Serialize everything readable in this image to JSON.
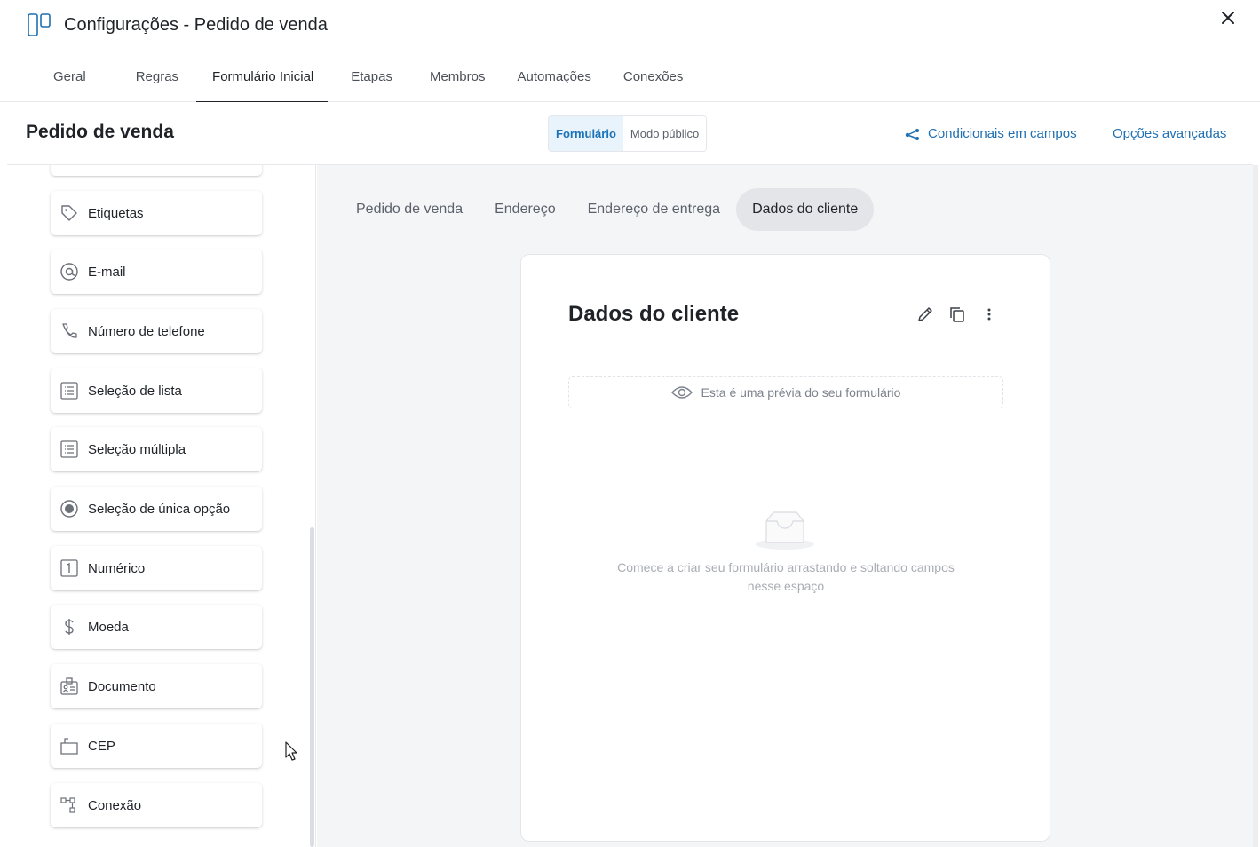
{
  "window": {
    "title": "Configurações - Pedido de venda",
    "app_icon": "board-columns-icon",
    "close_icon": "close-icon"
  },
  "tabs": [
    {
      "label": "Geral",
      "active": false
    },
    {
      "label": "Regras",
      "active": false
    },
    {
      "label": "Formulário Inicial",
      "active": true
    },
    {
      "label": "Etapas",
      "active": false
    },
    {
      "label": "Membros",
      "active": false
    },
    {
      "label": "Automações",
      "active": false
    },
    {
      "label": "Conexões",
      "active": false
    }
  ],
  "toolbar": {
    "page_title": "Pedido de venda",
    "view_toggle": [
      {
        "label": "Formulário",
        "active": true
      },
      {
        "label": "Modo público",
        "active": false
      }
    ],
    "conditionals_label": "Condicionais em campos",
    "advanced_label": "Opções avançadas"
  },
  "sidebar": {
    "fields": [
      {
        "label": "Etiquetas",
        "icon": "tag-icon"
      },
      {
        "label": "E-mail",
        "icon": "at-sign-icon"
      },
      {
        "label": "Número de telefone",
        "icon": "phone-icon"
      },
      {
        "label": "Seleção de lista",
        "icon": "list-icon"
      },
      {
        "label": "Seleção múltipla",
        "icon": "multi-list-icon"
      },
      {
        "label": "Seleção de única opção",
        "icon": "radio-icon"
      },
      {
        "label": "Numérico",
        "icon": "number-icon"
      },
      {
        "label": "Moeda",
        "icon": "dollar-icon"
      },
      {
        "label": "Documento",
        "icon": "id-card-icon"
      },
      {
        "label": "CEP",
        "icon": "mailbox-icon"
      },
      {
        "label": "Conexão",
        "icon": "hierarchy-icon"
      }
    ]
  },
  "steps": [
    {
      "label": "Pedido de venda",
      "active": false
    },
    {
      "label": "Endereço",
      "active": false
    },
    {
      "label": "Endereço de entrega",
      "active": false
    },
    {
      "label": "Dados do cliente",
      "active": true
    }
  ],
  "form_card": {
    "title": "Dados do cliente",
    "preview_note": "Esta é uma prévia do seu formulário",
    "empty_line1": "Comece a criar seu formulário arrastando e soltando campos",
    "empty_line2": "nesse espaço"
  },
  "colors": {
    "accent": "#1f6fb2",
    "active_tab_bg": "#e8f3fb",
    "background": "#f4f5f7"
  }
}
